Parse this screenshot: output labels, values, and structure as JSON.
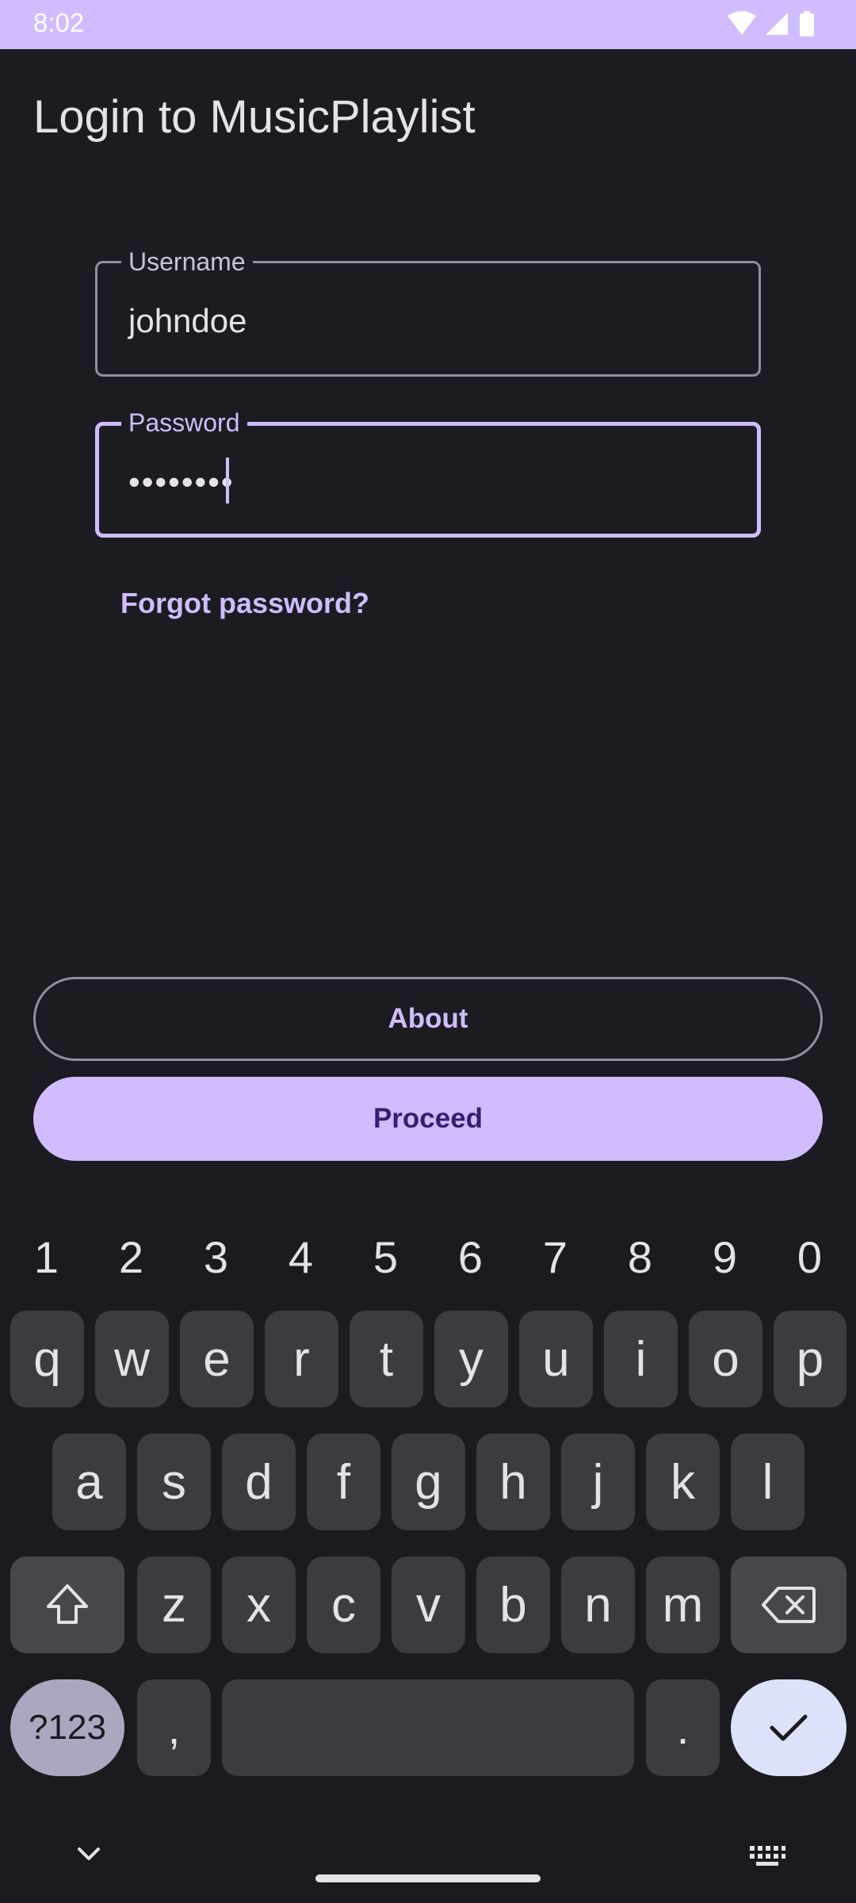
{
  "status_bar": {
    "time": "8:02",
    "icons": [
      "wifi-icon",
      "cellular-signal-icon",
      "battery-icon"
    ]
  },
  "header": {
    "title": "Login to MusicPlaylist"
  },
  "form": {
    "username": {
      "label": "Username",
      "value": "johndoe"
    },
    "password": {
      "label": "Password",
      "value": "••••••••",
      "focused": true
    }
  },
  "forgot_password": "Forgot password?",
  "buttons": {
    "about": "About",
    "proceed": "Proceed"
  },
  "keyboard": {
    "number_row": [
      "1",
      "2",
      "3",
      "4",
      "5",
      "6",
      "7",
      "8",
      "9",
      "0"
    ],
    "row1": [
      "q",
      "w",
      "e",
      "r",
      "t",
      "y",
      "u",
      "i",
      "o",
      "p"
    ],
    "row2": [
      "a",
      "s",
      "d",
      "f",
      "g",
      "h",
      "j",
      "k",
      "l"
    ],
    "row3": [
      "z",
      "x",
      "c",
      "v",
      "b",
      "n",
      "m"
    ],
    "symbols_key": "?123",
    "comma_key": ",",
    "period_key": "."
  },
  "colors": {
    "accent": "#d0bcff",
    "background": "#1c1b21",
    "on_accent": "#381e72"
  }
}
